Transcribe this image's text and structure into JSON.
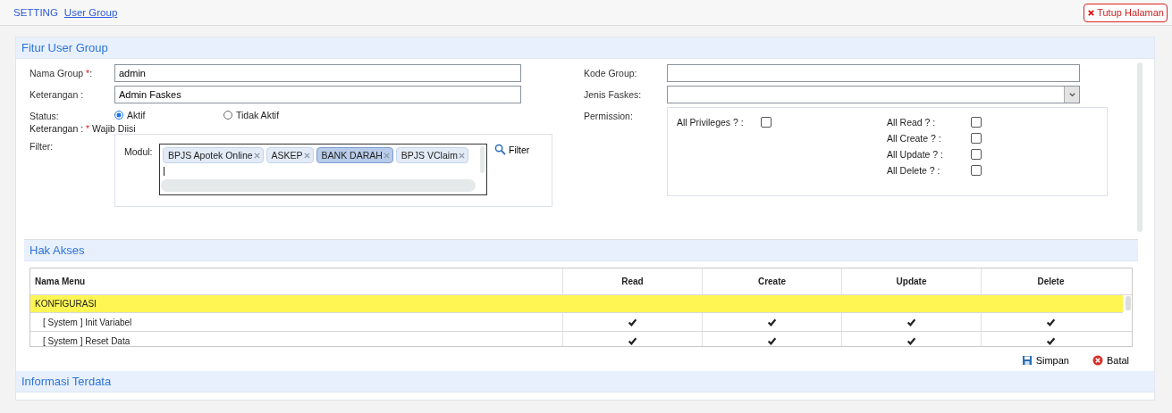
{
  "breadcrumb": [
    {
      "label": "SETTING",
      "selected": false
    },
    {
      "label": "User Group",
      "selected": true
    }
  ],
  "close_button": {
    "label": "Tutup Halaman"
  },
  "form_section": {
    "title": "Fitur User Group",
    "left_fields": [
      {
        "label": "Nama Group ",
        "mark": "*",
        "suffix": ":",
        "value": "admin"
      },
      {
        "label": "Keterangan :",
        "value": "Admin Faskes"
      }
    ],
    "status": {
      "label": "Status:",
      "options": [
        {
          "label": "Aktif",
          "selected": true
        },
        {
          "label": "Tidak Aktif",
          "selected": false
        }
      ]
    },
    "note": {
      "label": "Keterangan : ",
      "mark": "*",
      "text": "Wajib Diisi"
    },
    "filter": {
      "label": "Filter:",
      "modul_label": "Modul:",
      "button": "Filter",
      "tags": [
        {
          "label": "BPJS Apotek Online",
          "selected": false
        },
        {
          "label": "ASKEP",
          "selected": false
        },
        {
          "label": "BANK DARAH",
          "selected": true
        },
        {
          "label": "BPJS VClaim",
          "selected": false
        }
      ]
    },
    "kode_group": {
      "label": "Kode Group:"
    },
    "jenis_faskes": {
      "label": "Jenis Faskes:"
    },
    "permission": {
      "label": "Permission:",
      "all_privileges": {
        "label": "All Privileges ? :",
        "checked": false
      },
      "items": [
        {
          "label": "All Read ? :",
          "checked": false
        },
        {
          "label": "All Create ? :",
          "checked": false
        },
        {
          "label": "All Update ? :",
          "checked": false
        },
        {
          "label": "All Delete ? :",
          "checked": false
        }
      ]
    }
  },
  "access_section": {
    "title": "Hak Akses",
    "columns": [
      "Nama Menu",
      "Read",
      "Create",
      "Update",
      "Delete"
    ],
    "rows": [
      {
        "kind": "group",
        "name": "KONFIGURASI"
      },
      {
        "kind": "item",
        "name": "[ System ] Init Variabel",
        "read": true,
        "create": true,
        "update": true,
        "delete": true
      },
      {
        "kind": "item",
        "name": "[ System ] Reset Data",
        "read": true,
        "create": true,
        "update": true,
        "delete": true
      }
    ],
    "save_button": "Simpan",
    "cancel_button": "Batal"
  },
  "info_section": {
    "title": "Informasi Terdata"
  }
}
